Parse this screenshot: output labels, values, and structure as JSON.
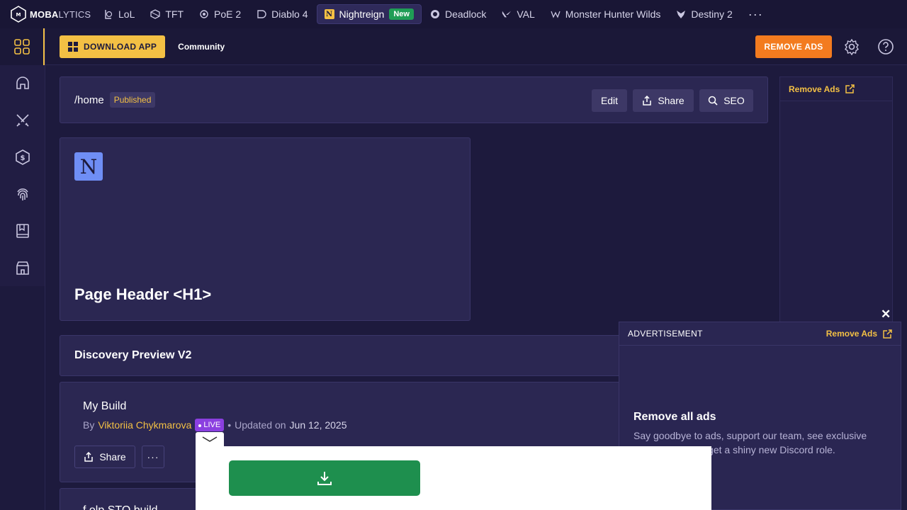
{
  "brand": {
    "logo_bold": "MOBA",
    "logo_thin": "LYTICS"
  },
  "games": [
    {
      "label": "LoL",
      "icon": "lol-icon"
    },
    {
      "label": "TFT",
      "icon": "tft-icon"
    },
    {
      "label": "PoE 2",
      "icon": "poe2-icon"
    },
    {
      "label": "Diablo 4",
      "icon": "diablo4-icon"
    },
    {
      "label": "Nightreign",
      "icon": "nightreign-icon",
      "badge": "New",
      "active": true
    },
    {
      "label": "Deadlock",
      "icon": "deadlock-icon"
    },
    {
      "label": "VAL",
      "icon": "valorant-icon"
    },
    {
      "label": "Monster Hunter Wilds",
      "icon": "mhw-icon"
    },
    {
      "label": "Destiny 2",
      "icon": "destiny2-icon"
    }
  ],
  "nav_more": "···",
  "subheader": {
    "download_label": "DOWNLOAD APP",
    "community_label": "Community",
    "remove_ads_label": "REMOVE ADS"
  },
  "rail_icons": [
    "apps-grid-icon",
    "helmet-icon",
    "swords-icon",
    "coin-icon",
    "fingerprint-icon",
    "book-icon",
    "store-icon"
  ],
  "page_bar": {
    "path": "/home",
    "status": "Published",
    "edit_label": "Edit",
    "share_label": "Share",
    "seo_label": "SEO"
  },
  "hero": {
    "icon_letter": "N",
    "title": "Page Header <H1>"
  },
  "discovery": {
    "title": "Discovery Preview V2"
  },
  "build_card": {
    "title": "My Build",
    "by_prefix": "By",
    "author": "Viktoriia Chykmarova",
    "live_label": "LIVE",
    "bullet": "•",
    "updated_prefix": "Updated on",
    "updated_date": "Jun 12, 2025",
    "share_label": "Share",
    "more_label": "···"
  },
  "next_card": {
    "title": "f olp STO build"
  },
  "ad_column": {
    "remove_label": "Remove Ads"
  },
  "ad_popup": {
    "close_label": "✕",
    "label": "ADVERTISEMENT",
    "remove_label": "Remove Ads",
    "heading": "Remove all ads",
    "text": "Say goodbye to ads, support our team, see exclusive perks and more, get a shiny new Discord role."
  },
  "colors": {
    "background": "#1d1a3d",
    "accent_yellow": "#f3c044",
    "accent_orange": "#f37b1f",
    "live_purple": "#8b3fe0",
    "download_green": "#1e8f4e"
  }
}
